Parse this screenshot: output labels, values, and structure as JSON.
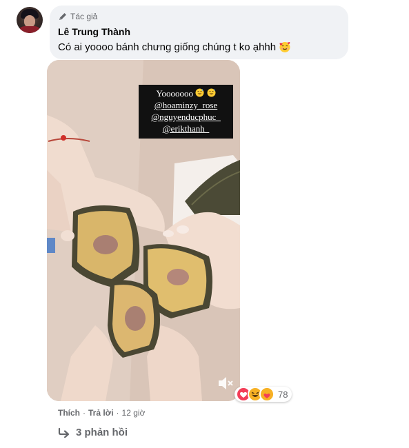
{
  "comment": {
    "badge_label": "Tác giả",
    "author_name": "Lê Trung Thành",
    "text": "Có ai yoooo bánh chưng giống chúng t ko ạhhh",
    "text_emoji": "smiling-face-with-hearts"
  },
  "media": {
    "caption_lines": [
      "Yooooooo",
      "@hoaminzy_rose",
      "@nguyenducphuc_",
      "@erikthanh_"
    ],
    "caption_emoji": "grinning-sweat-emoji",
    "mute_icon": "speaker-muted-icon"
  },
  "reactions": {
    "types": [
      "love",
      "haha",
      "care"
    ],
    "count": "78"
  },
  "actions": {
    "like_label": "Thích",
    "separator": "·",
    "reply_label": "Trả lời",
    "timestamp": "12 giờ"
  },
  "replies": {
    "label": "3 phản hồi",
    "icon": "reply-arrow-icon"
  },
  "colors": {
    "bubble_bg": "#f0f2f5",
    "secondary_text": "#65676b",
    "love": "#f33e58",
    "haha": "#f7b125"
  }
}
